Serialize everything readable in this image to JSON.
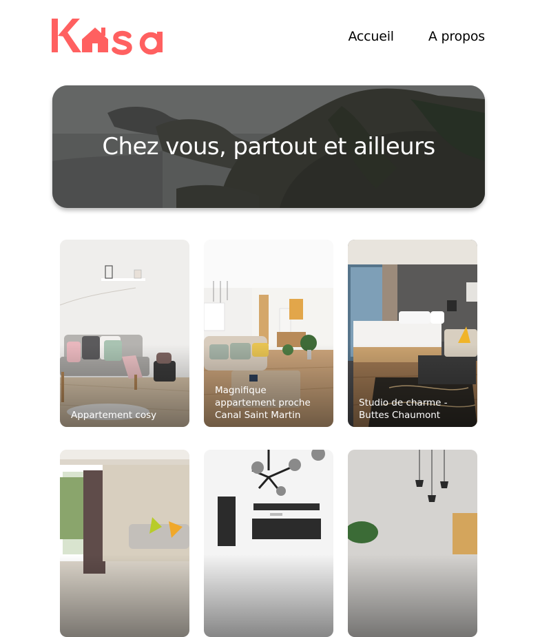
{
  "brand": {
    "logo_text": "Kasa",
    "accent": "#FF6060"
  },
  "nav": {
    "home_label": "Accueil",
    "about_label": "A propos"
  },
  "banner": {
    "title": "Chez vous, partout et ailleurs"
  },
  "listings": [
    {
      "title": "Appartement cosy"
    },
    {
      "title": "Magnifique appartement proche Canal Saint Martin"
    },
    {
      "title": "Studio de charme - Buttes Chaumont"
    },
    {
      "title": ""
    },
    {
      "title": ""
    },
    {
      "title": ""
    }
  ]
}
